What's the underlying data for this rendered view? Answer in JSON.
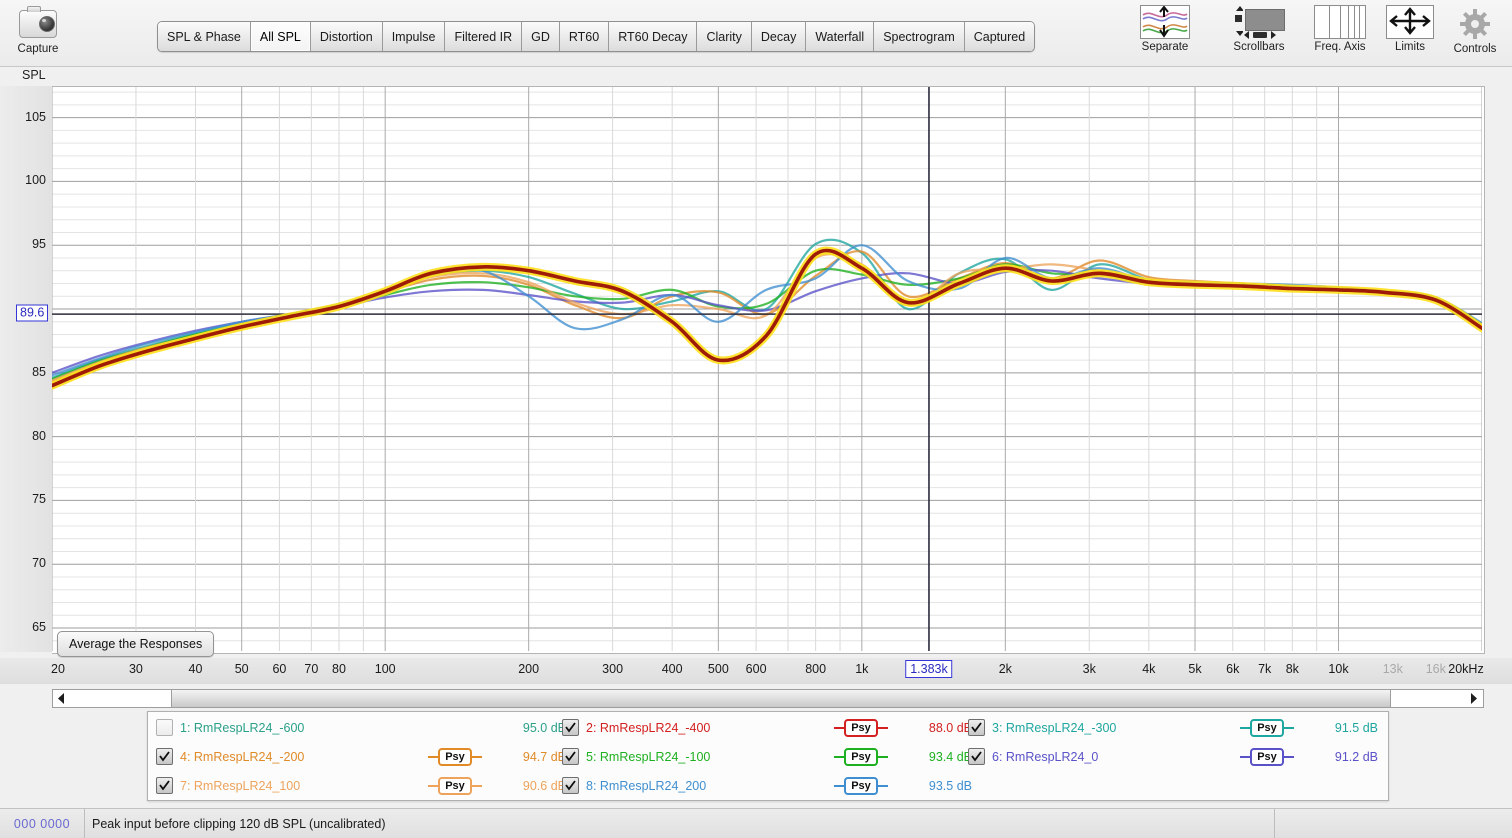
{
  "app": {
    "title": "REW - All SPL"
  },
  "toolbar": {
    "capture": {
      "label": "Capture",
      "icon": "camera-icon"
    },
    "right_buttons": [
      {
        "label": "Separate",
        "icon": "separate-traces-icon"
      },
      {
        "label": "Scrollbars",
        "icon": "scrollbars-icon"
      },
      {
        "label": "Freq. Axis",
        "icon": "frequency-axis-icon"
      },
      {
        "label": "Limits",
        "icon": "limits-icon"
      },
      {
        "label": "Controls",
        "icon": "gear-icon"
      }
    ]
  },
  "tabs": [
    {
      "label": "SPL & Phase",
      "selected": false
    },
    {
      "label": "All SPL",
      "selected": true
    },
    {
      "label": "Distortion",
      "selected": false
    },
    {
      "label": "Impulse",
      "selected": false
    },
    {
      "label": "Filtered IR",
      "selected": false
    },
    {
      "label": "GD",
      "selected": false
    },
    {
      "label": "RT60",
      "selected": false
    },
    {
      "label": "RT60 Decay",
      "selected": false
    },
    {
      "label": "Clarity",
      "selected": false
    },
    {
      "label": "Decay",
      "selected": false
    },
    {
      "label": "Waterfall",
      "selected": false
    },
    {
      "label": "Spectrogram",
      "selected": false
    },
    {
      "label": "Captured",
      "selected": false
    }
  ],
  "graph": {
    "y_axis_title": "SPL",
    "y_cursor_value": "89.6",
    "x_cursor_value": "1.383k",
    "average_button": "Average the Responses"
  },
  "chart_data": {
    "type": "line",
    "title": "All SPL",
    "xlabel": "",
    "ylabel": "SPL",
    "x_scale": "log",
    "xlim": [
      20,
      20000
    ],
    "ylim": [
      63.2,
      107.4
    ],
    "grid": true,
    "legend": "bottom",
    "y_ticks": [
      105,
      100,
      95,
      90,
      85,
      80,
      75,
      70,
      65
    ],
    "y_tick_labels": [
      "105",
      "100",
      "95",
      "90",
      "85",
      "80",
      "75",
      "70",
      "65"
    ],
    "x_ticks": [
      20,
      30,
      40,
      50,
      60,
      70,
      80,
      100,
      200,
      300,
      400,
      500,
      600,
      800,
      1000,
      2000,
      3000,
      4000,
      5000,
      6000,
      7000,
      8000,
      10000,
      13000,
      16000,
      20000
    ],
    "x_tick_labels": [
      "20",
      "30",
      "40",
      "50",
      "60",
      "70",
      "80",
      "100",
      "200",
      "300",
      "400",
      "500",
      "600",
      "800",
      "1k",
      "2k",
      "3k",
      "4k",
      "5k",
      "6k",
      "7k",
      "8k",
      "10k",
      "13k",
      "16k",
      "20kHz"
    ],
    "x_tick_dimmed": [
      "13k",
      "16k"
    ],
    "cursor_horizontal_db": 89.6,
    "cursor_vertical_hz": 1383,
    "x_points": [
      20,
      25,
      31,
      40,
      50,
      63,
      80,
      100,
      125,
      160,
      200,
      250,
      315,
      400,
      500,
      630,
      800,
      1000,
      1250,
      1600,
      2000,
      2500,
      3150,
      4000,
      5000,
      6300,
      8000,
      10000,
      12500,
      16000,
      20000
    ],
    "series": [
      {
        "name": "1: RmRespLR24_-600",
        "color": "#2aa089",
        "checked": false,
        "psy": false,
        "level_db": "95.0 dB",
        "values": [
          84.7,
          86.0,
          87.1,
          88.2,
          89.0,
          89.7,
          90.4,
          91.3,
          92.4,
          92.7,
          92.3,
          91.6,
          91.2,
          91.4,
          90.2,
          90.6,
          93.6,
          92.1,
          90.8,
          92.3,
          93.4,
          92.0,
          93.3,
          92.2,
          92.0,
          91.9,
          91.7,
          91.5,
          91.3,
          90.8,
          88.9
        ]
      },
      {
        "name": "2: RmRespLR24_-400",
        "color": "#d32020",
        "checked": true,
        "psy": true,
        "level_db": "88.0 dB",
        "values": [
          84.0,
          85.5,
          86.6,
          87.7,
          88.6,
          89.4,
          90.2,
          91.4,
          92.8,
          93.3,
          93.0,
          92.2,
          91.4,
          89.0,
          86.0,
          87.9,
          94.3,
          93.2,
          90.5,
          92.0,
          93.2,
          92.2,
          92.8,
          92.1,
          91.9,
          91.8,
          91.6,
          91.5,
          91.3,
          90.7,
          88.5
        ]
      },
      {
        "name": "3: RmRespLR24_-300",
        "color": "#1fa6a0",
        "checked": true,
        "psy": true,
        "level_db": "91.5 dB",
        "values": [
          84.6,
          86.0,
          87.0,
          88.1,
          88.9,
          89.6,
          90.4,
          91.4,
          92.6,
          93.0,
          92.5,
          91.2,
          90.0,
          90.6,
          91.4,
          90.0,
          95.1,
          94.4,
          90.0,
          92.8,
          93.9,
          91.5,
          93.5,
          92.3,
          92.1,
          91.9,
          91.8,
          91.6,
          91.4,
          90.9,
          88.8
        ]
      },
      {
        "name": "4: RmRespLR24_-200",
        "color": "#e08a28",
        "checked": true,
        "psy": true,
        "level_db": "94.7 dB",
        "values": [
          84.3,
          85.7,
          86.8,
          87.9,
          88.8,
          89.5,
          90.3,
          91.3,
          92.3,
          92.6,
          91.9,
          90.3,
          89.3,
          91.0,
          91.3,
          89.6,
          92.6,
          94.5,
          91.0,
          92.4,
          93.6,
          92.4,
          93.8,
          92.5,
          92.2,
          92.0,
          91.8,
          91.6,
          91.4,
          90.9,
          88.7
        ]
      },
      {
        "name": "5: RmRespLR24_-100",
        "color": "#1eb020",
        "checked": true,
        "psy": true,
        "level_db": "93.4 dB",
        "values": [
          84.5,
          85.9,
          86.9,
          88.0,
          88.8,
          89.5,
          90.2,
          91.1,
          91.9,
          92.1,
          91.7,
          91.0,
          90.8,
          91.5,
          90.2,
          90.4,
          93.0,
          92.7,
          91.9,
          92.4,
          93.5,
          92.8,
          92.7,
          92.1,
          92.0,
          91.9,
          91.8,
          91.6,
          91.4,
          90.9,
          88.8
        ]
      },
      {
        "name": "6: RmRespLR24_0",
        "color": "#5a52c8",
        "checked": true,
        "psy": true,
        "level_db": "91.2 dB",
        "values": [
          85.0,
          86.3,
          87.3,
          88.3,
          89.0,
          89.6,
          90.2,
          90.9,
          91.4,
          91.5,
          91.1,
          90.6,
          90.5,
          91.1,
          90.3,
          89.9,
          91.4,
          92.4,
          92.8,
          92.0,
          92.9,
          93.0,
          92.4,
          92.0,
          91.9,
          91.8,
          91.7,
          91.5,
          91.3,
          90.8,
          88.7
        ]
      },
      {
        "name": "7: RmRespLR24_100",
        "color": "#eda35c",
        "checked": true,
        "psy": true,
        "level_db": "90.6 dB",
        "values": [
          84.4,
          85.8,
          86.9,
          87.9,
          88.8,
          89.5,
          90.3,
          91.4,
          92.5,
          92.8,
          92.1,
          90.5,
          89.6,
          90.3,
          90.0,
          89.5,
          94.0,
          93.5,
          90.3,
          92.8,
          93.1,
          93.5,
          93.0,
          92.3,
          92.1,
          91.9,
          91.7,
          91.6,
          91.4,
          90.9,
          88.7
        ]
      },
      {
        "name": "8: RmRespLR24_200",
        "color": "#3f8fd0",
        "checked": true,
        "psy": true,
        "level_db": "93.5 dB",
        "values": [
          84.8,
          86.1,
          87.2,
          88.2,
          89.0,
          89.6,
          90.3,
          91.2,
          92.9,
          93.0,
          91.0,
          88.5,
          89.2,
          91.1,
          89.0,
          91.5,
          92.4,
          95.0,
          92.2,
          91.6,
          94.0,
          92.4,
          93.2,
          92.2,
          92.1,
          92.0,
          91.9,
          91.7,
          91.4,
          90.9,
          88.9
        ]
      }
    ],
    "highlighted_series": {
      "name": "average",
      "color": "#9e1b08",
      "halo": "#ffe01a",
      "values": [
        84.0,
        85.5,
        86.6,
        87.7,
        88.6,
        89.4,
        90.2,
        91.4,
        92.8,
        93.3,
        93.0,
        92.2,
        91.4,
        89.0,
        86.0,
        87.9,
        94.3,
        93.2,
        90.5,
        92.0,
        93.2,
        92.2,
        92.8,
        92.1,
        91.9,
        91.8,
        91.6,
        91.5,
        91.3,
        90.7,
        88.5
      ]
    }
  },
  "legend": {
    "psy_label": "Psy",
    "rows": [
      [
        {
          "index": 1,
          "name": "1: RmRespLR24_-600",
          "color": "#2aa089",
          "checked": false,
          "psy": false,
          "db": "95.0 dB"
        },
        {
          "index": 2,
          "name": "2: RmRespLR24_-400",
          "color": "#d32020",
          "checked": true,
          "psy": true,
          "db": "88.0 dB"
        },
        {
          "index": 3,
          "name": "3: RmRespLR24_-300",
          "color": "#1fa6a0",
          "checked": true,
          "psy": true,
          "db": "91.5 dB"
        }
      ],
      [
        {
          "index": 4,
          "name": "4: RmRespLR24_-200",
          "color": "#e08a28",
          "checked": true,
          "psy": true,
          "db": "94.7 dB"
        },
        {
          "index": 5,
          "name": "5: RmRespLR24_-100",
          "color": "#1eb020",
          "checked": true,
          "psy": true,
          "db": "93.4 dB"
        },
        {
          "index": 6,
          "name": "6: RmRespLR24_0",
          "color": "#5a52c8",
          "checked": true,
          "psy": true,
          "db": "91.2 dB"
        }
      ],
      [
        {
          "index": 7,
          "name": "7: RmRespLR24_100",
          "color": "#eda35c",
          "checked": true,
          "psy": true,
          "db": "90.6 dB"
        },
        {
          "index": 8,
          "name": "8: RmRespLR24_200",
          "color": "#3f8fd0",
          "checked": true,
          "psy": true,
          "db": "93.5 dB"
        }
      ]
    ]
  },
  "status_bar": {
    "meter": "000 0000",
    "message": "Peak input before clipping 120 dB SPL (uncalibrated)"
  }
}
